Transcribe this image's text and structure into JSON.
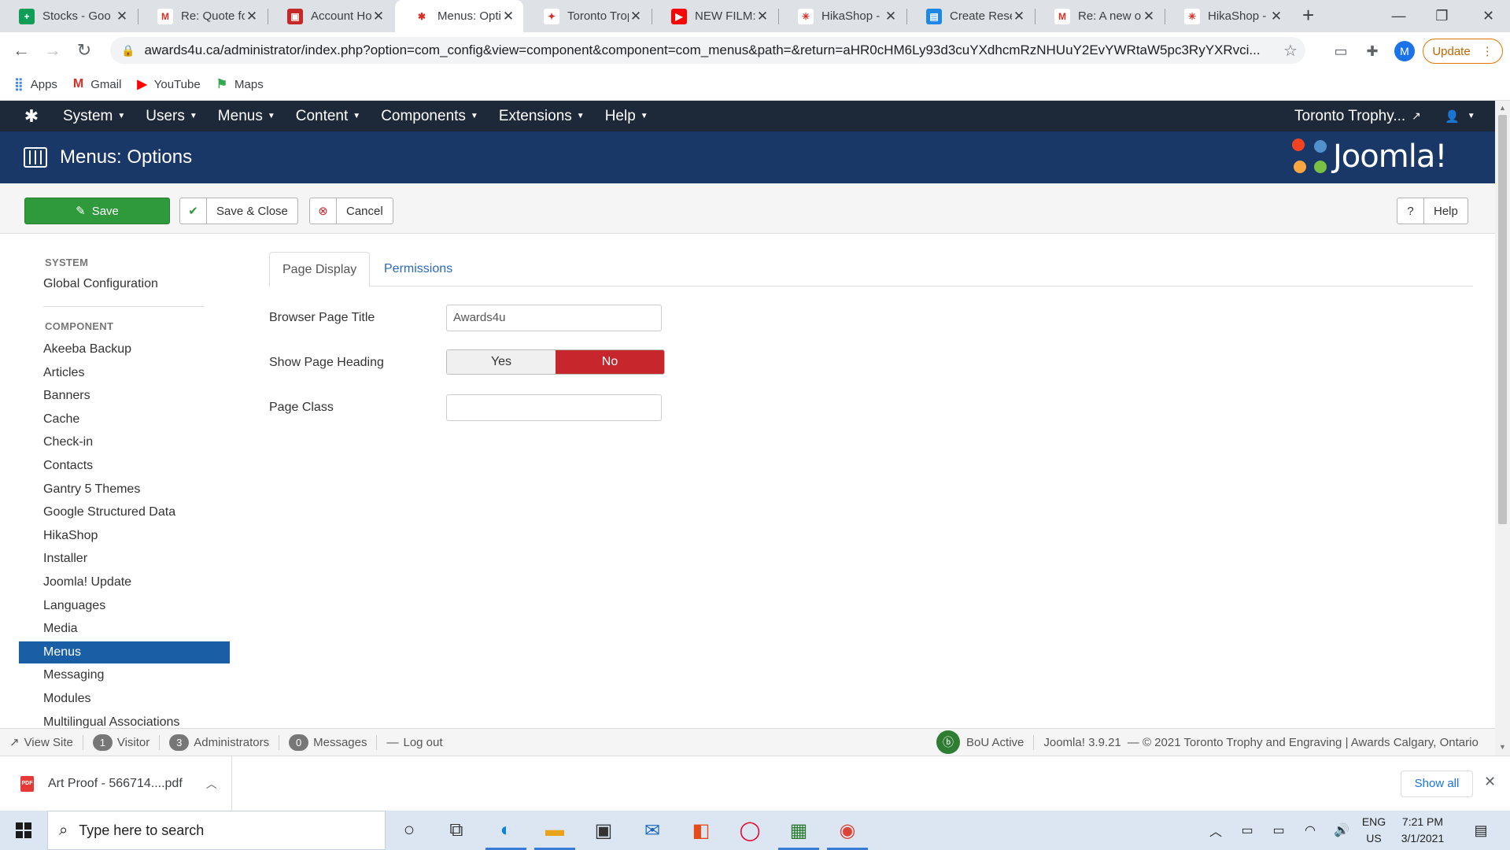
{
  "browser": {
    "tabs": [
      {
        "title": "Stocks - Goo",
        "color": "#0f9d58",
        "glyph": "+"
      },
      {
        "title": "Re: Quote fo",
        "color": "#ffffff",
        "glyph": "M"
      },
      {
        "title": "Account Hol",
        "color": "#c62828",
        "glyph": "▣"
      },
      {
        "title": "Menus: Opti",
        "color": "#ffffff",
        "glyph": "✱"
      },
      {
        "title": "Toronto Trop",
        "color": "#ffffff",
        "glyph": "✦"
      },
      {
        "title": "NEW FILM: I",
        "color": "#ff0000",
        "glyph": "▶"
      },
      {
        "title": "HikaShop - I",
        "color": "#ffffff",
        "glyph": "✳"
      },
      {
        "title": "Create Reser",
        "color": "#1e88e5",
        "glyph": "▤"
      },
      {
        "title": "Re: A new or",
        "color": "#ffffff",
        "glyph": "M"
      },
      {
        "title": "HikaShop - C",
        "color": "#ffffff",
        "glyph": "✳"
      }
    ],
    "active_tab": 3,
    "url": "awards4u.ca/administrator/index.php?option=com_config&view=component&component=com_menus&path=&return=aHR0cHM6Ly93d3cuYXdhcmRzNHUuY2EvYWRtaW5pc3RyYXRvci...",
    "profile_initial": "M",
    "update_label": "Update",
    "bookmarks": [
      {
        "label": "Apps",
        "icon": "apps-grid-icon"
      },
      {
        "label": "Gmail",
        "icon": "gmail-icon"
      },
      {
        "label": "YouTube",
        "icon": "youtube-icon"
      },
      {
        "label": "Maps",
        "icon": "maps-icon"
      }
    ]
  },
  "joomla": {
    "nav": {
      "menus": [
        "System",
        "Users",
        "Menus",
        "Content",
        "Components",
        "Extensions",
        "Help"
      ],
      "site_name": "Toronto Trophy..."
    },
    "header": {
      "title": "Menus: Options",
      "brand": "Joomla!"
    },
    "toolbar": {
      "save": "Save",
      "save_close": "Save & Close",
      "cancel": "Cancel",
      "help": "Help"
    },
    "sidebar": {
      "system_heading": "SYSTEM",
      "system_items": [
        "Global Configuration"
      ],
      "component_heading": "COMPONENT",
      "component_items": [
        "Akeeba Backup",
        "Articles",
        "Banners",
        "Cache",
        "Check-in",
        "Contacts",
        "Gantry 5 Themes",
        "Google Structured Data",
        "HikaShop",
        "Installer",
        "Joomla! Update",
        "Languages",
        "Media",
        "Menus",
        "Messaging",
        "Modules",
        "Multilingual Associations"
      ],
      "active_item": "Menus"
    },
    "tabs": {
      "page_display": "Page Display",
      "permissions": "Permissions"
    },
    "form": {
      "browser_page_title_label": "Browser Page Title",
      "browser_page_title_value": "Awards4u",
      "show_page_heading_label": "Show Page Heading",
      "yes": "Yes",
      "no": "No",
      "selected": "No",
      "page_class_label": "Page Class",
      "page_class_value": ""
    },
    "status": {
      "view_site": "View Site",
      "visitor_count": "1",
      "visitor_label": "Visitor",
      "admin_count": "3",
      "admin_label": "Administrators",
      "message_count": "0",
      "message_label": "Messages",
      "logout": "Log out",
      "bou": "BoU Active",
      "version": "Joomla! 3.9.21",
      "copyright": "— © 2021 Toronto Trophy and Engraving | Awards Calgary, Ontario"
    }
  },
  "download": {
    "file": "Art Proof - 566714....pdf",
    "show_all": "Show all"
  },
  "taskbar": {
    "search_placeholder": "Type here to search",
    "lang_top": "ENG",
    "lang_bottom": "US",
    "time": "7:21 PM",
    "date": "3/1/2021"
  }
}
